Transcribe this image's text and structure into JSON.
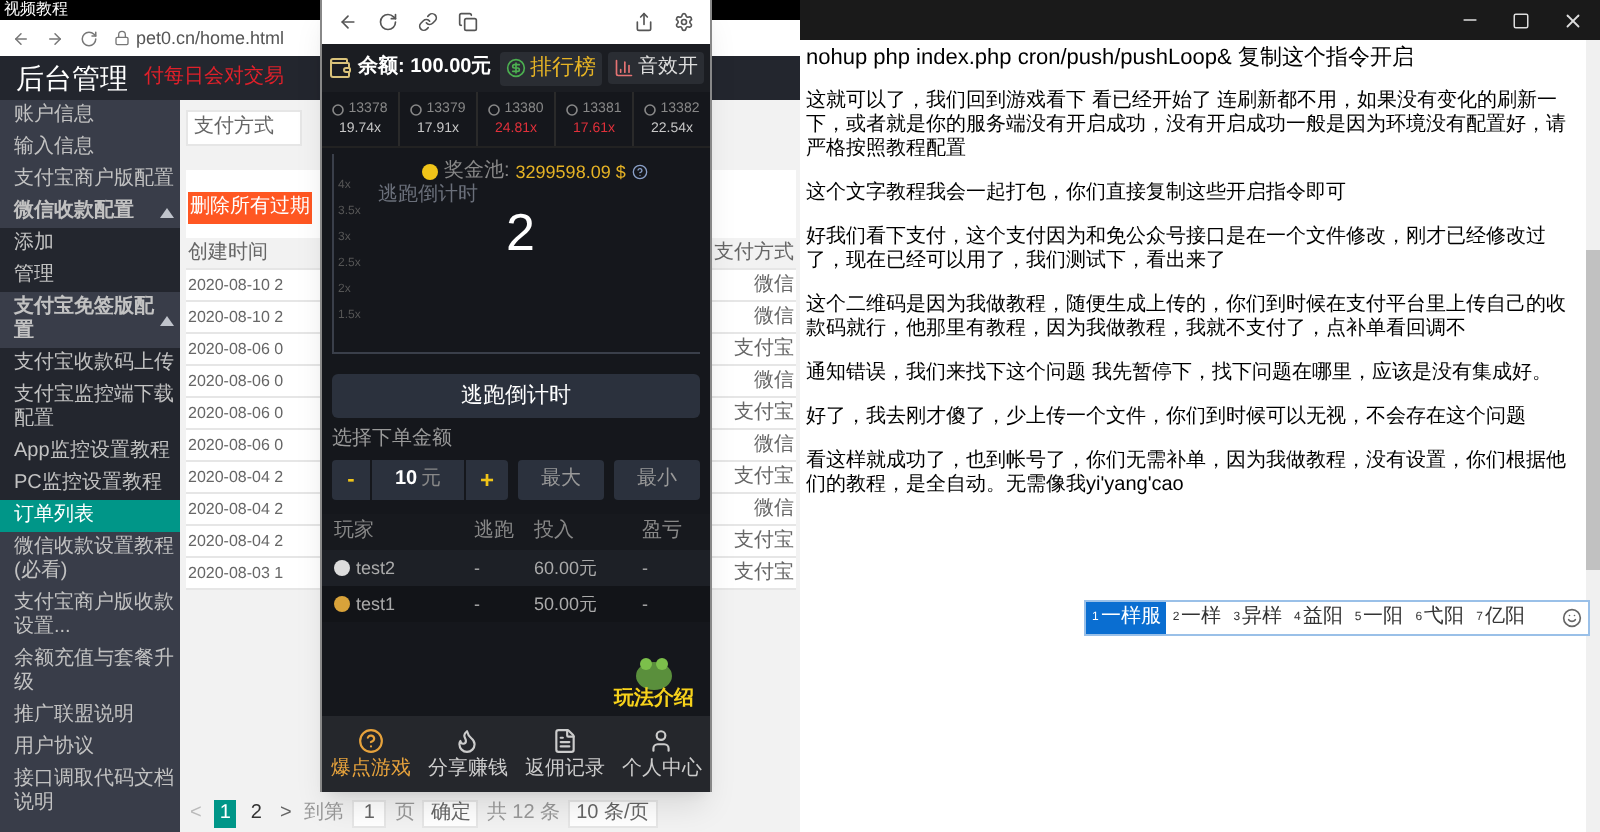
{
  "browser": {
    "tab_title": "视频教程",
    "url": "pet0.cn/home.html"
  },
  "admin": {
    "title": "后台管理",
    "notice": "付每日会对交易",
    "sidebar": {
      "items": [
        {
          "label": "账户信息",
          "selected": false
        },
        {
          "label": "输入信息",
          "selected": false
        },
        {
          "label": "支付宝商户版配置",
          "selected": false
        },
        {
          "label": "微信收款配置",
          "selected": false,
          "expanded": true,
          "children": [
            {
              "label": "添加",
              "selected": false
            },
            {
              "label": "管理",
              "selected": false
            }
          ]
        },
        {
          "label": "支付宝免签版配置",
          "selected": false,
          "expanded": true,
          "children": [
            {
              "label": "支付宝收款码上传",
              "selected": false
            },
            {
              "label": "支付宝监控端下载配置",
              "selected": false
            },
            {
              "label": "App监控设置教程",
              "selected": false
            },
            {
              "label": "PC监控设置教程",
              "selected": false
            }
          ]
        },
        {
          "label": "订单列表",
          "selected": true
        },
        {
          "label": "微信收款设置教程(必看)",
          "selected": false
        },
        {
          "label": "支付宝商户版收款设置...",
          "selected": false
        },
        {
          "label": "余额充值与套餐升级",
          "selected": false
        },
        {
          "label": "推广联盟说明",
          "selected": false
        },
        {
          "label": "用户协议",
          "selected": false
        },
        {
          "label": "接口调取代码文档说明",
          "selected": false
        }
      ]
    },
    "filter": {
      "value": "支付方式"
    },
    "delete_button": "删除所有过期",
    "table": {
      "columns": [
        "创建时间",
        "支付方式"
      ],
      "rows": [
        [
          "2020-08-10 2",
          "微信"
        ],
        [
          "2020-08-10 2",
          "微信"
        ],
        [
          "2020-08-06 0",
          "支付宝"
        ],
        [
          "2020-08-06 0",
          "微信"
        ],
        [
          "2020-08-06 0",
          "支付宝"
        ],
        [
          "2020-08-06 0",
          "微信"
        ],
        [
          "2020-08-04 2",
          "支付宝"
        ],
        [
          "2020-08-04 2",
          "微信"
        ],
        [
          "2020-08-04 2",
          "支付宝"
        ],
        [
          "2020-08-03 1",
          "支付宝"
        ]
      ]
    },
    "pagination": {
      "prev": "<",
      "pages": [
        {
          "label": "1",
          "selected": true
        },
        {
          "label": "2",
          "selected": false
        }
      ],
      "next": ">",
      "goto_label": "到第",
      "goto_value": "1",
      "page_unit": "页",
      "confirm": "确定",
      "total": "共 12 条",
      "page_size": "10 条/页"
    }
  },
  "game": {
    "balance": "余额: 100.00元",
    "leaderboard": "排行榜",
    "sound": "音效开",
    "rounds": [
      {
        "round": "13378",
        "multiplier": "19.74x",
        "color": "#c8c8c8"
      },
      {
        "round": "13379",
        "multiplier": "17.91x",
        "color": "#c8c8c8"
      },
      {
        "round": "13380",
        "multiplier": "24.81x",
        "color": "#e0303a"
      },
      {
        "round": "13381",
        "multiplier": "17.61x",
        "color": "#e0303a"
      },
      {
        "round": "13382",
        "multiplier": "22.54x",
        "color": "#c8c8c8"
      }
    ],
    "pool_label": "奖金池:",
    "pool_value": "3299598.09 $",
    "countdown": "2",
    "faint_label": "逃跑倒计时",
    "axis_labels": [
      "4x",
      "3.5x",
      "3x",
      "2.5x",
      "2x",
      "1.5x"
    ],
    "escape_button": "逃跑倒计时",
    "amount_label": "选择下单金额",
    "stepper": {
      "minus": "-",
      "value": "10",
      "unit": "元",
      "plus": "+"
    },
    "max_button": "最大",
    "min_button": "最小",
    "players": {
      "columns": [
        "玩家",
        "逃跑",
        "投入",
        "盈亏"
      ],
      "rows": [
        [
          "test2",
          "-",
          "60.00元",
          "-"
        ],
        [
          "test1",
          "-",
          "50.00元",
          "-"
        ]
      ]
    },
    "guide": "玩法介绍",
    "nav": [
      {
        "label": "爆点游戏",
        "selected": true
      },
      {
        "label": "分享赚钱",
        "selected": false
      },
      {
        "label": "返佣记录",
        "selected": false
      },
      {
        "label": "个人中心",
        "selected": false
      }
    ]
  },
  "notepad": {
    "paragraphs": [
      "nohup php index.php cron/push/pushLoop& 复制这个指令开启",
      "这就可以了，我们回到游戏看下 看已经开始了 连刷新都不用，如果没有变化的刷新一下，或者就是你的服务端没有开启成功，没有开启成功一般是因为环境没有配置好，请严格按照教程配置",
      "这个文字教程我会一起打包，你们直接复制这些开启指令即可",
      "好我们看下支付，这个支付因为和免公众号接口是在一个文件修改，刚才已经修改过了，现在已经可以用了，我们测试下，看出来了",
      "这个二维码是因为我做教程，随便生成上传的，你们到时候在支付平台里上传自己的收款码就行，他那里有教程，因为我做教程，我就不支付了，点补单看回调不",
      "通知错误，我们来找下这个问题  我先暂停下，找下问题在哪里，应该是没有集成好。",
      "好了，我去刚才傻了，少上传一个文件，你们到时候可以无视，不会存在这个问题",
      "看这样就成功了，也到帐号了，你们无需补单，因为我做教程，没有设置，你们根据他们的教程，是全自动。无需像我yi'yang'cao"
    ],
    "ime": {
      "candidates": [
        {
          "index": "1",
          "text": "一样服",
          "selected": true
        },
        {
          "index": "2",
          "text": "一样",
          "selected": false
        },
        {
          "index": "3",
          "text": "异样",
          "selected": false
        },
        {
          "index": "4",
          "text": "益阳",
          "selected": false
        },
        {
          "index": "5",
          "text": "一阳",
          "selected": false
        },
        {
          "index": "6",
          "text": "弋阳",
          "selected": false
        },
        {
          "index": "7",
          "text": "亿阳",
          "selected": false
        }
      ]
    }
  }
}
